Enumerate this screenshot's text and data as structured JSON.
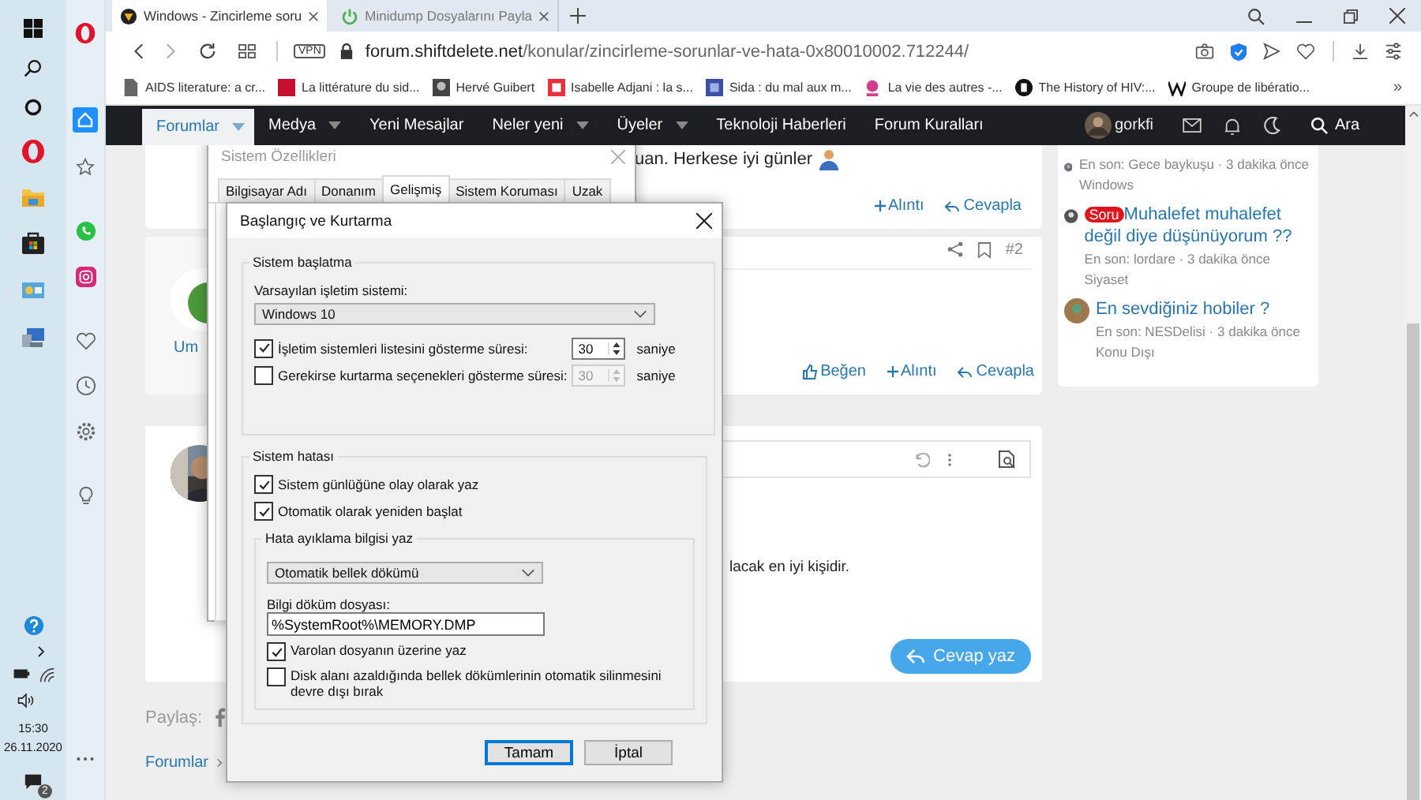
{
  "taskbar": {
    "time": "15:30",
    "date": "26.11.2020",
    "notification_count": "2"
  },
  "browser": {
    "tabs": [
      {
        "title": "Windows - Zincirleme soru",
        "selected": true
      },
      {
        "title": "Minidump Dosyalarını Payla",
        "selected": false
      }
    ],
    "address": {
      "vpn": "VPN",
      "domain": "forum.shiftdelete.net",
      "path": "/konular/zincirleme-sorunlar-ve-hata-0x80010002.712244/"
    },
    "bookmarks": [
      "AIDS literature: a cr...",
      "La littérature du sid...",
      "Hervé Guibert",
      "Isabelle Adjani : la s...",
      "Sida : du mal aux m...",
      "La vie des autres -...",
      "The History of HIV:...",
      "Groupe de libératio..."
    ],
    "more_bookmarks": "»"
  },
  "site": {
    "nav": [
      {
        "label": "Forumlar",
        "selected": true,
        "dropdown": true
      },
      {
        "label": "Medya",
        "selected": false,
        "dropdown": true
      },
      {
        "label": "Yeni Mesajlar",
        "selected": false,
        "dropdown": false
      },
      {
        "label": "Neler yeni",
        "selected": false,
        "dropdown": true
      },
      {
        "label": "Üyeler",
        "selected": false,
        "dropdown": true
      },
      {
        "label": "Teknoloji Haberleri",
        "selected": false,
        "dropdown": false
      },
      {
        "label": "Forum Kuralları",
        "selected": false,
        "dropdown": false
      }
    ],
    "user": "gorkfi",
    "search": "Ara",
    "post_1": {
      "text": "uan. Herkese iyi günler",
      "actions": [
        "Alıntı",
        "Cevapla"
      ]
    },
    "post_2": {
      "user_name": "Um",
      "number": "#2",
      "actions": [
        "Beğen",
        "Alıntı",
        "Cevapla"
      ]
    },
    "reply": {
      "text": "lacak en iyi kişidir.",
      "button": "Cevap yaz"
    },
    "share_label": "Paylaş:",
    "breadcrumb": [
      "Forumlar"
    ],
    "sidebar": [
      {
        "meta": "En son: Gece baykuşu · 3 dakika önce",
        "forum": "Windows"
      },
      {
        "badge": "Soru",
        "title": "Muhalefet muhalefet değil diye düşünüyorum ??",
        "meta": "En son: lordare · 3 dakika önce",
        "forum": "Siyaset"
      },
      {
        "title": "En sevdiğiniz hobiler ?",
        "meta": "En son: NESDelisi · 3 dakika önce",
        "forum": "Konu Dışı"
      }
    ]
  },
  "system_properties": {
    "title": "Sistem Özellikleri",
    "tabs": [
      {
        "label": "Bilgisayar Adı",
        "selected": false
      },
      {
        "label": "Donanım",
        "selected": false
      },
      {
        "label": "Gelişmiş",
        "selected": true
      },
      {
        "label": "Sistem Koruması",
        "selected": false
      },
      {
        "label": "Uzak",
        "selected": false
      }
    ]
  },
  "startup_recovery": {
    "title": "Başlangıç ve Kurtarma",
    "startup": {
      "legend": "Sistem başlatma",
      "os_label": "Varsayılan işletim sistemi:",
      "os_value": "Windows 10",
      "rows": [
        {
          "label": "İşletim sistemleri listesini gösterme süresi:",
          "checked": true,
          "value": "30",
          "unit": "saniye"
        },
        {
          "label": "Gerekirse kurtarma seçenekleri gösterme süresi:",
          "checked": false,
          "value": "30",
          "unit": "saniye"
        }
      ]
    },
    "failure": {
      "legend": "Sistem hatası",
      "options": [
        {
          "label": "Sistem günlüğüne olay olarak yaz",
          "checked": true
        },
        {
          "label": "Otomatik olarak yeniden başlat",
          "checked": true
        }
      ],
      "debug": {
        "legend": "Hata ayıklama bilgisi yaz",
        "dump_type": "Otomatik bellek dökümü",
        "file_label": "Bilgi döküm dosyası:",
        "file_value": "%SystemRoot%\\MEMORY.DMP",
        "options": [
          {
            "label": "Varolan dosyanın üzerine yaz",
            "checked": true
          },
          {
            "label": "Disk alanı azaldığında bellek dökümlerinin otomatik silinmesini devre dışı bırak",
            "checked": false
          }
        ]
      }
    },
    "buttons": [
      {
        "label": "Tamam",
        "default": true
      },
      {
        "label": "İptal",
        "default": false
      }
    ]
  }
}
